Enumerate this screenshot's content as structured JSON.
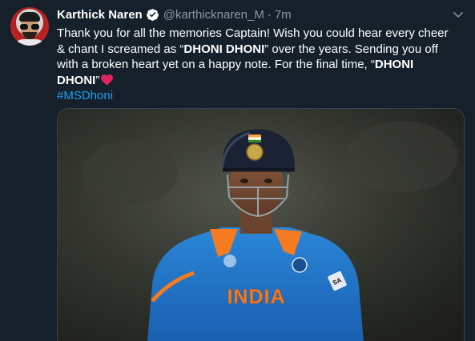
{
  "tweet": {
    "author_name": "Karthick Naren",
    "handle": "@karthicknaren_M",
    "separator": "·",
    "time": "7m",
    "body": {
      "line1": "Thank you for all the memories Captain! Wish you could hear every cheer",
      "line2_a": "& chant I screamed as “",
      "line2_bold": "DHONI DHONI",
      "line2_b": "” over the years. Sending you off",
      "line3_a": "with a broken heart yet on a happy note. For the final time, “",
      "line3_bold": "DHONI",
      "line4_bold": "DHONI",
      "line4_a": "”"
    },
    "hashtag": "#MSDhoni",
    "media": {
      "jersey_text": "INDIA",
      "sponsor_text": "SA"
    }
  },
  "colors": {
    "background": "#15202b",
    "secondary_text": "#8899a6",
    "link": "#1da1f2",
    "heart": "#e0245e",
    "jersey_blue": "#1d6ec4"
  },
  "icons": {
    "verified": "verified-badge-icon",
    "more": "chevron-down-icon",
    "heart": "red-heart-emoji"
  }
}
